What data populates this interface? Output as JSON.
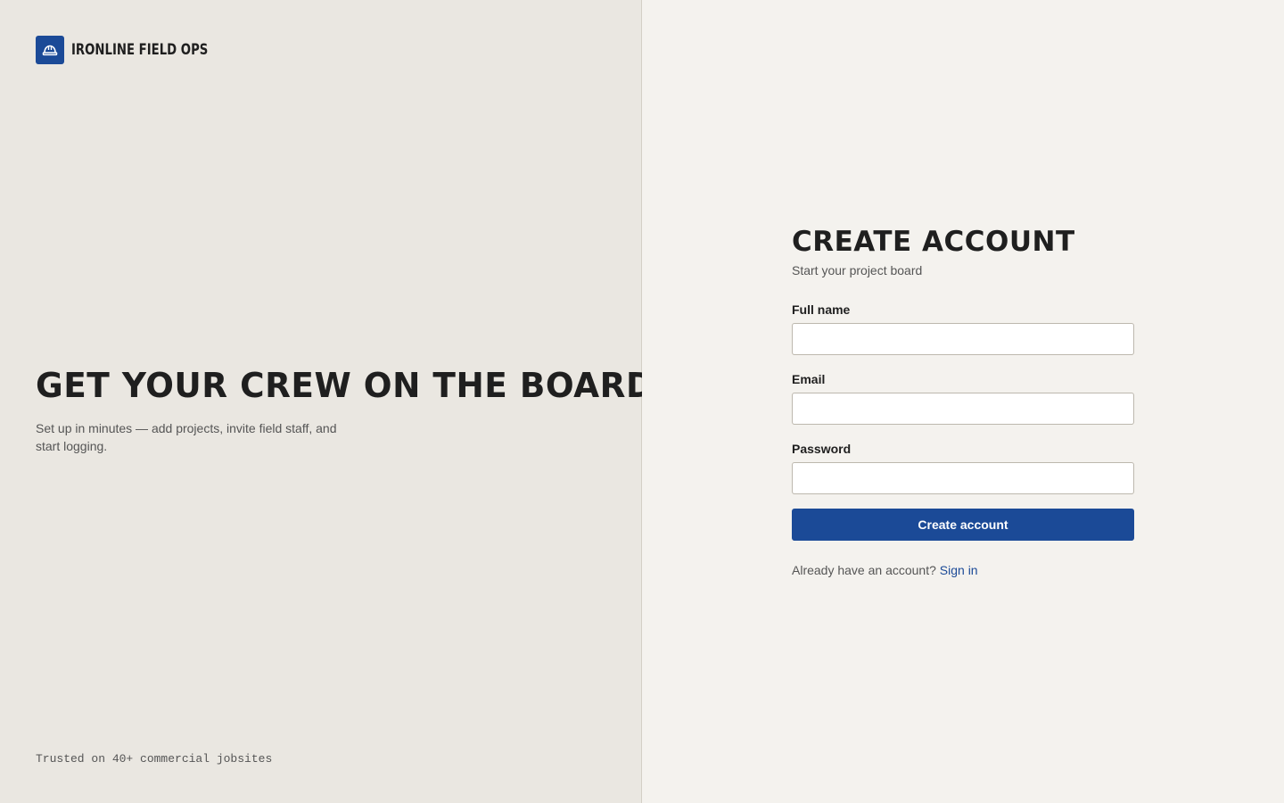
{
  "brand": {
    "name": "IRONLINE FIELD OPS",
    "icon": "hard-hat-icon",
    "accent_color": "#1b4a97"
  },
  "hero": {
    "title": "GET YOUR CREW ON THE BOARD.",
    "subtitle": "Set up in minutes — add projects, invite field staff, and start logging."
  },
  "footer": {
    "trust_text": "Trusted on 40+ commercial jobsites"
  },
  "form": {
    "title": "CREATE ACCOUNT",
    "subtitle": "Start your project board",
    "fields": [
      {
        "label": "Full name",
        "value": "",
        "placeholder": ""
      },
      {
        "label": "Email",
        "value": "",
        "placeholder": ""
      },
      {
        "label": "Password",
        "value": "",
        "placeholder": ""
      }
    ],
    "submit_label": "Create account",
    "signin_prompt": "Already have an account?",
    "signin_link": "Sign in"
  },
  "colors": {
    "left_bg": "#eae7e1",
    "right_bg": "#f4f2ee",
    "primary": "#1b4a97"
  }
}
